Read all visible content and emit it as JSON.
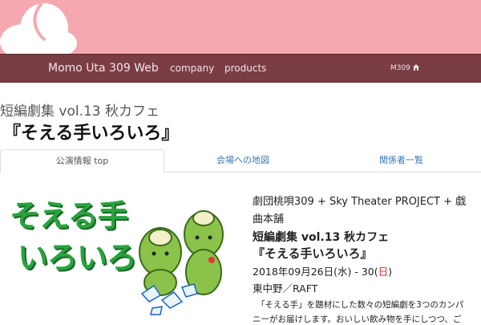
{
  "nav": {
    "brand": "Momo Uta 309 Web",
    "items": [
      "company",
      "products"
    ],
    "right_label": "M309",
    "right_icon": "home-icon"
  },
  "heading": {
    "subtitle": "短編劇集 vol.13 秋カフェ",
    "title": "『そえる手いろいろ』"
  },
  "tabs": [
    {
      "label": "公演情報 top",
      "active": true
    },
    {
      "label": "会場への地図",
      "active": false
    },
    {
      "label": "関係者一覧",
      "active": false
    }
  ],
  "flyer": {
    "line1": "そえる手",
    "line2": "いろいろ"
  },
  "info": {
    "organizer_line1": "劇団桃唄309 + Sky Theater PROJECT + 戯",
    "organizer_line2": "曲本舗",
    "event": "短編劇集 vol.13 秋カフェ",
    "title": "『そえる手いろいろ』",
    "date_prefix": "2018年09月26日(水) - 30(",
    "date_sunday": "日",
    "date_suffix": ")",
    "venue": "東中野／RAFT",
    "desc_line1": "「そえる手」を題材にした数々の短編劇を3つのカンパ",
    "desc_line2": "ニーがお届けします。おいしい飲み物を手にしつつ、ご"
  },
  "colors": {
    "banner": "#f5a8b0",
    "navbar": "#7a3d44",
    "link": "#337ab7",
    "flyer_green": "#29a33f",
    "sunday_red": "#d9302c"
  }
}
